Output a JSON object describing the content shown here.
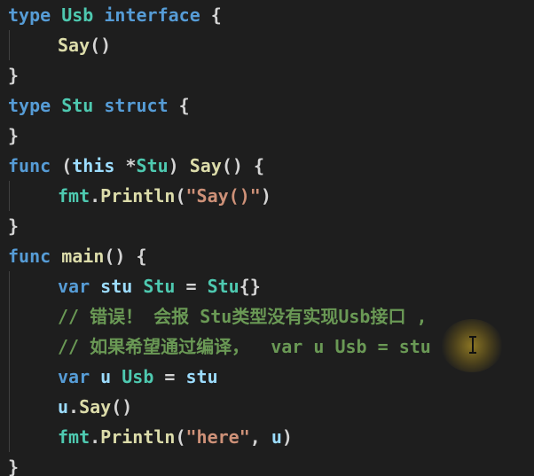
{
  "editor": {
    "lines": [
      {
        "indent": 0,
        "tokens": [
          {
            "t": "type",
            "c": "kw"
          },
          {
            "t": " ",
            "c": "pl"
          },
          {
            "t": "Usb",
            "c": "tp"
          },
          {
            "t": " ",
            "c": "pl"
          },
          {
            "t": "interface",
            "c": "kw"
          },
          {
            "t": " {",
            "c": "pl"
          }
        ]
      },
      {
        "indent": 2,
        "tokens": [
          {
            "t": "Say",
            "c": "fn"
          },
          {
            "t": "()",
            "c": "pl"
          }
        ]
      },
      {
        "indent": 0,
        "tokens": [
          {
            "t": "}",
            "c": "pl"
          }
        ]
      },
      {
        "indent": 0,
        "tokens": [
          {
            "t": "type",
            "c": "kw"
          },
          {
            "t": " ",
            "c": "pl"
          },
          {
            "t": "Stu",
            "c": "tp"
          },
          {
            "t": " ",
            "c": "pl"
          },
          {
            "t": "struct",
            "c": "kw"
          },
          {
            "t": " {",
            "c": "pl"
          }
        ]
      },
      {
        "indent": 0,
        "tokens": [
          {
            "t": "}",
            "c": "pl"
          }
        ]
      },
      {
        "indent": 0,
        "tokens": [
          {
            "t": "func",
            "c": "kw"
          },
          {
            "t": " (",
            "c": "pl"
          },
          {
            "t": "this",
            "c": "vr"
          },
          {
            "t": " *",
            "c": "pl"
          },
          {
            "t": "Stu",
            "c": "tp"
          },
          {
            "t": ") ",
            "c": "pl"
          },
          {
            "t": "Say",
            "c": "fn"
          },
          {
            "t": "() {",
            "c": "pl"
          }
        ]
      },
      {
        "indent": 2,
        "tokens": [
          {
            "t": "fmt",
            "c": "tp"
          },
          {
            "t": ".",
            "c": "pl"
          },
          {
            "t": "Println",
            "c": "fn"
          },
          {
            "t": "(",
            "c": "pl"
          },
          {
            "t": "\"Say()\"",
            "c": "str"
          },
          {
            "t": ")",
            "c": "pl"
          }
        ]
      },
      {
        "indent": 0,
        "tokens": [
          {
            "t": "}",
            "c": "pl"
          }
        ]
      },
      {
        "indent": 0,
        "tokens": [
          {
            "t": "func",
            "c": "kw"
          },
          {
            "t": " ",
            "c": "pl"
          },
          {
            "t": "main",
            "c": "fn"
          },
          {
            "t": "() {",
            "c": "pl"
          }
        ]
      },
      {
        "indent": 2,
        "tokens": [
          {
            "t": "var",
            "c": "kw"
          },
          {
            "t": " ",
            "c": "pl"
          },
          {
            "t": "stu",
            "c": "vr"
          },
          {
            "t": " ",
            "c": "pl"
          },
          {
            "t": "Stu",
            "c": "tp"
          },
          {
            "t": " = ",
            "c": "pl"
          },
          {
            "t": "Stu",
            "c": "tp"
          },
          {
            "t": "{}",
            "c": "pl"
          }
        ]
      },
      {
        "indent": 2,
        "tokens": [
          {
            "t": "// 错误！ 会报 Stu类型没有实现Usb接口 ,",
            "c": "cm"
          }
        ]
      },
      {
        "indent": 2,
        "tokens": [
          {
            "t": "// 如果希望通过编译，  var u Usb = stu",
            "c": "cm"
          }
        ]
      },
      {
        "indent": 2,
        "tokens": [
          {
            "t": "var",
            "c": "kw"
          },
          {
            "t": " ",
            "c": "pl"
          },
          {
            "t": "u",
            "c": "vr"
          },
          {
            "t": " ",
            "c": "pl"
          },
          {
            "t": "Usb",
            "c": "tp"
          },
          {
            "t": " = ",
            "c": "pl"
          },
          {
            "t": "stu",
            "c": "vr"
          }
        ]
      },
      {
        "indent": 2,
        "tokens": [
          {
            "t": "u",
            "c": "vr"
          },
          {
            "t": ".",
            "c": "pl"
          },
          {
            "t": "Say",
            "c": "fn"
          },
          {
            "t": "()",
            "c": "pl"
          }
        ]
      },
      {
        "indent": 2,
        "tokens": [
          {
            "t": "fmt",
            "c": "tp"
          },
          {
            "t": ".",
            "c": "pl"
          },
          {
            "t": "Println",
            "c": "fn"
          },
          {
            "t": "(",
            "c": "pl"
          },
          {
            "t": "\"here\"",
            "c": "str"
          },
          {
            "t": ", ",
            "c": "pl"
          },
          {
            "t": "u",
            "c": "vr"
          },
          {
            "t": ")",
            "c": "pl"
          }
        ]
      },
      {
        "indent": 0,
        "tokens": [
          {
            "t": "}",
            "c": "pl"
          }
        ]
      }
    ],
    "guides": [
      {
        "from_line": 1,
        "to_line": 1
      },
      {
        "from_line": 6,
        "to_line": 6
      },
      {
        "from_line": 9,
        "to_line": 14
      }
    ],
    "colors": {
      "background": "#1e1e1e",
      "keyword": "#569cd6",
      "type": "#4ec9b0",
      "function": "#dcdcaa",
      "variable": "#9cdcfe",
      "string": "#ce9178",
      "comment": "#6a9955",
      "plain": "#d4d4d4",
      "highlight": "#e6be28"
    },
    "cursor_icon": "text-cursor-icon"
  }
}
